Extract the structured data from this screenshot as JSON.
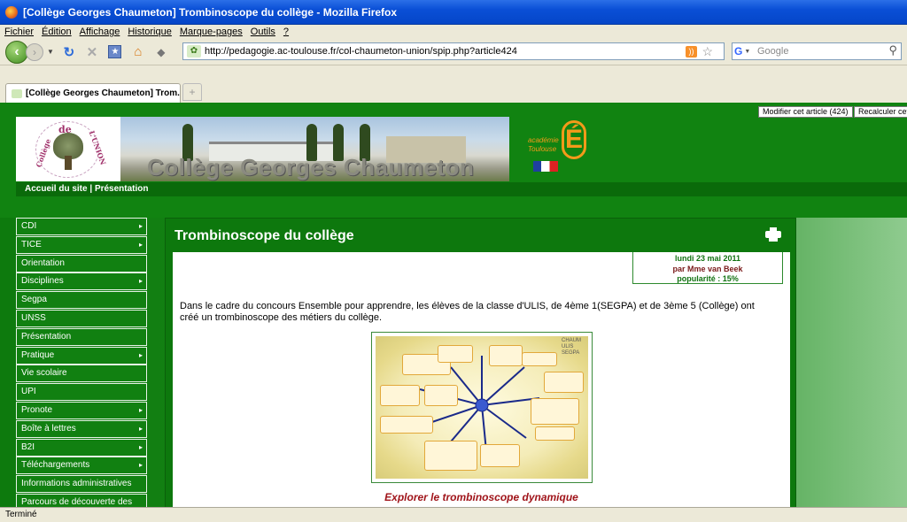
{
  "window": {
    "title": "[Collège Georges Chaumeton] Trombinoscope du collège - Mozilla Firefox"
  },
  "menu": [
    "Fichier",
    "Édition",
    "Affichage",
    "Historique",
    "Marque-pages",
    "Outils",
    "?"
  ],
  "nav": {
    "url": "http://pedagogie.ac-toulouse.fr/col-chaumeton-union/spip.php?article424",
    "search_placeholder": "Google"
  },
  "tab": {
    "label": "[Collège Georges Chaumeton] Trom..."
  },
  "admin": {
    "edit": "Modifier cet article (424)",
    "recalc": "Recalculer cet"
  },
  "banner": {
    "school_name": "Collège Georges Chaumeton",
    "logo_de": "de",
    "logo_college": "Collège",
    "logo_union": "L'UNION",
    "academie_line1": "académie",
    "academie_line2": "Toulouse",
    "academie_mark": "É"
  },
  "breadcrumb": {
    "home": "Accueil du site",
    "sep": " | ",
    "section": "Présentation"
  },
  "sidebar": [
    {
      "label": "CDI",
      "arrow": "▸"
    },
    {
      "label": "TICE",
      "arrow": "▸"
    },
    {
      "label": "Orientation",
      "arrow": ""
    },
    {
      "label": "Disciplines",
      "arrow": "▸"
    },
    {
      "label": "Segpa",
      "arrow": ""
    },
    {
      "label": "UNSS",
      "arrow": ""
    },
    {
      "label": "Présentation",
      "arrow": ""
    },
    {
      "label": "Pratique",
      "arrow": "▸"
    },
    {
      "label": "Vie scolaire",
      "arrow": ""
    },
    {
      "label": "UPI",
      "arrow": ""
    },
    {
      "label": "Pronote",
      "arrow": "▸"
    },
    {
      "label": "Boîte à lettres",
      "arrow": "▸"
    },
    {
      "label": "B2I",
      "arrow": "▸"
    },
    {
      "label": "Téléchargements",
      "arrow": "▸"
    },
    {
      "label": "Informations administratives",
      "arrow": ""
    },
    {
      "label": "Parcours de découverte des",
      "arrow": ""
    }
  ],
  "article": {
    "title": "Trombinoscope du collège",
    "date": "lundi 23 mai 2011",
    "author_prefix": "par",
    "author": "Mme van Beek",
    "popularity": "popularité : 15%",
    "body": "Dans le cadre du concours Ensemble pour apprendre, les élèves de la classe d'ULIS, de 4ème 1(SEGPA) et de 3ème 5 (Collège) ont créé un trombinoscope des métiers du collège.",
    "link": "Explorer le trombinoscope dynamique",
    "thumb_tag": "CHAUM ULIS SEGPA"
  },
  "status": {
    "text": "Terminé"
  }
}
